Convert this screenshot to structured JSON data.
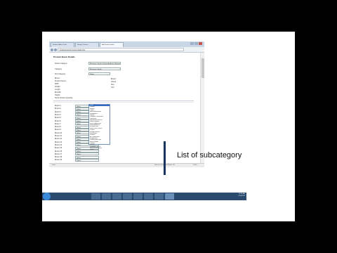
{
  "browser": {
    "tabs": [
      {
        "label": "Solutions Admin Panel",
        "active": false
      },
      {
        "label": "Manage Products",
        "active": false
      },
      {
        "label": "Add Product Details",
        "active": true
      }
    ],
    "url": "localhost/admin/product/add.php"
  },
  "form": {
    "title": "Product Basic Details",
    "fields": [
      {
        "label": "Select Category",
        "value": "Electronic Goods & Home Appliance Equipment"
      },
      {
        "label": "Category",
        "value": "Electronic Goods"
      },
      {
        "label": "Sub Category",
        "value": "Select"
      },
      {
        "label": "Brand",
        "value": ""
      },
      {
        "label": "Product Name",
        "value": ""
      },
      {
        "label": "MRP",
        "value": ""
      },
      {
        "label": "Weight",
        "value": ""
      },
      {
        "label": "Length",
        "value": ""
      },
      {
        "label": "Breadth",
        "value": ""
      },
      {
        "label": "Height",
        "value": ""
      },
      {
        "label": "Stock Product Quantity",
        "value": ""
      }
    ],
    "subcategory_options": [
      "Select",
      "Camera",
      "Mobiles",
      "Tablets",
      "Mobile Accessories",
      "Headphones",
      "Laptops",
      "Computer Peripherals",
      "Televisions",
      "Home Audio Devices",
      "Game Consoles",
      "Kitchen Appliances",
      "Home Appliances",
      "Personal Care",
      "Health Care Devices",
      "Printers",
      "Storage Devices",
      "Networking",
      "Software",
      "Air Conditioners",
      "Refrigerators",
      "Washing Machines",
      "Water Heaters",
      "Cooling",
      "Heating",
      "Wearable Devices",
      "Musical Instruments",
      "Others"
    ],
    "right_labels": [
      "Brand",
      "Colour",
      "Size",
      "Unit"
    ],
    "variant_rows": [
      {
        "label": "Brand 1",
        "value": "Select"
      },
      {
        "label": "Brand 2",
        "value": "Select"
      },
      {
        "label": "Brand 3",
        "value": "Select"
      },
      {
        "label": "Brand 4",
        "value": "Select"
      },
      {
        "label": "Brand 5",
        "value": "Select"
      },
      {
        "label": "Brand 6",
        "value": "Select"
      },
      {
        "label": "Brand 7",
        "value": "Select"
      },
      {
        "label": "Brand 8",
        "value": "Select"
      },
      {
        "label": "Brand 9",
        "value": "Select"
      },
      {
        "label": "Brand 10",
        "value": "Select"
      },
      {
        "label": "Brand 11",
        "value": "Select"
      },
      {
        "label": "Brand 12",
        "value": "Select"
      },
      {
        "label": "Brand 13",
        "value": "Select"
      },
      {
        "label": "Brand 14",
        "value": "Select"
      },
      {
        "label": "Brand 15",
        "value": "Select"
      },
      {
        "label": "Brand 16",
        "value": "Select"
      },
      {
        "label": "Brand 17",
        "value": "Select"
      },
      {
        "label": "Brand 18",
        "value": "Select"
      },
      {
        "label": "Brand 19",
        "value": "Select"
      }
    ]
  },
  "statusbar": {
    "left": "Done",
    "right": "Internet | Protected Mode: Off",
    "zoom": "100%"
  },
  "taskbar": {
    "clock_time": "11:39 AM",
    "clock_date": "7/20/2012"
  },
  "annotation": "List of subcategory"
}
